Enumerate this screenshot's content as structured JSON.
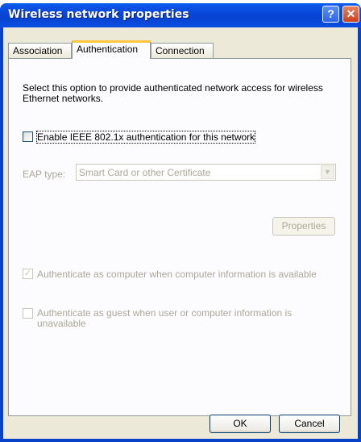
{
  "window": {
    "title": "Wireless network properties",
    "help_label": "?",
    "close_label": "✕"
  },
  "tabs": [
    {
      "label": "Association"
    },
    {
      "label": "Authentication"
    },
    {
      "label": "Connection"
    }
  ],
  "authentication": {
    "description": "Select this option to provide authenticated network access for wireless Ethernet networks.",
    "enable_8021x": {
      "label": "Enable IEEE 802.1x authentication for this network",
      "checked": false
    },
    "eap_type": {
      "label": "EAP type:",
      "value": "Smart Card or other Certificate",
      "enabled": false
    },
    "properties_label": "Properties",
    "auth_as_computer": {
      "label": "Authenticate as computer when computer information is available",
      "checked": true,
      "enabled": false
    },
    "auth_as_guest": {
      "label": "Authenticate as guest when user or computer information is unavailable",
      "checked": false,
      "enabled": false
    }
  },
  "buttons": {
    "ok": "OK",
    "cancel": "Cancel"
  },
  "icons": {
    "checkmark": "✓",
    "dropdown_arrow": "▼"
  }
}
